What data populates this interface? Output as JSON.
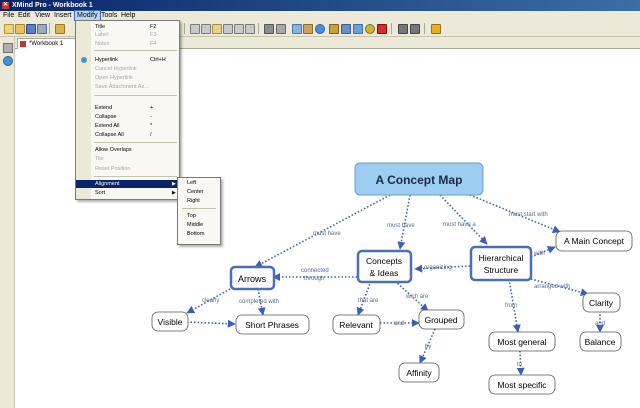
{
  "window": {
    "title": "XMind Pro - Workbook 1"
  },
  "menubar": {
    "items": [
      "File",
      "Edit",
      "View",
      "Insert",
      "Modify",
      "Tools",
      "Help"
    ]
  },
  "tab": {
    "label": "*Workbook 1"
  },
  "modify_menu": {
    "items": [
      {
        "label": "Title",
        "accel": "F2",
        "disabled": false
      },
      {
        "label": "Label",
        "accel": "F3",
        "disabled": true
      },
      {
        "label": "Notes",
        "accel": "F4",
        "disabled": true
      },
      {
        "label": "Hyperlink",
        "accel": "Ctrl+H",
        "disabled": false
      },
      {
        "label": "Cancel Hyperlink",
        "accel": "",
        "disabled": true
      },
      {
        "label": "Open Hyperlink",
        "accel": "",
        "disabled": true
      },
      {
        "label": "Save Attachment As...",
        "accel": "",
        "disabled": true
      },
      {
        "label": "Extend",
        "accel": "+",
        "disabled": false
      },
      {
        "label": "Collapse",
        "accel": "-",
        "disabled": false
      },
      {
        "label": "Extend All",
        "accel": "*",
        "disabled": false
      },
      {
        "label": "Collapse All",
        "accel": "/",
        "disabled": false
      },
      {
        "label": "Allow Overlaps",
        "accel": "",
        "disabled": false
      },
      {
        "label": "Tile",
        "accel": "",
        "disabled": true
      },
      {
        "label": "Reset Position",
        "accel": "",
        "disabled": true
      },
      {
        "label": "Alignment",
        "accel": "",
        "disabled": false
      },
      {
        "label": "Sort",
        "accel": "",
        "disabled": false
      }
    ]
  },
  "alignment_submenu": {
    "items": [
      "Left",
      "Center",
      "Right",
      "Top",
      "Middle",
      "Bottom"
    ]
  },
  "map": {
    "central": "A Concept Map",
    "nodes": {
      "arrows": "Arrows",
      "concepts_line1": "Concepts",
      "concepts_line2": "& Ideas",
      "hier_line1": "Hierarchical",
      "hier_line2": "Structure",
      "main_concept": "A Main Concept",
      "visible": "Visible",
      "short_phrases": "Short Phrases",
      "relevant": "Relevant",
      "grouped": "Grouped",
      "affinity": "Affinity",
      "most_general": "Most general",
      "most_specific": "Most specific",
      "clarity": "Clarity",
      "balance": "Balance"
    },
    "links": {
      "must_have_1": "must have",
      "must_have_2": "must have",
      "must_have_3": "must have a",
      "must_start_with": "must start with",
      "connected": "connected",
      "through": "through",
      "organizing": "organizing",
      "with": "with",
      "clearly": "clearly",
      "completed_with": "completed with",
      "that_are": "that are",
      "wich_are": "wich are",
      "and_1": "and",
      "by": "by",
      "from": "from",
      "to": "to",
      "arranged_with": "arranged with",
      "and_2": "and"
    }
  },
  "colors": {
    "central_fill": "#9ecdf2",
    "central_border": "#6a9fcf",
    "node_border": "#4a6fb5",
    "link": "#3a5fb8",
    "menu_highlight": "#0a246a"
  }
}
